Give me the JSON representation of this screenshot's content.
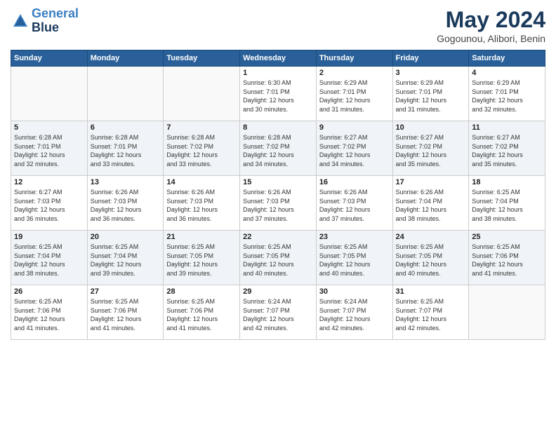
{
  "header": {
    "logo_line1": "General",
    "logo_line2": "Blue",
    "month": "May 2024",
    "location": "Gogounou, Alibori, Benin"
  },
  "weekdays": [
    "Sunday",
    "Monday",
    "Tuesday",
    "Wednesday",
    "Thursday",
    "Friday",
    "Saturday"
  ],
  "weeks": [
    [
      {
        "day": "",
        "info": ""
      },
      {
        "day": "",
        "info": ""
      },
      {
        "day": "",
        "info": ""
      },
      {
        "day": "1",
        "info": "Sunrise: 6:30 AM\nSunset: 7:01 PM\nDaylight: 12 hours\nand 30 minutes."
      },
      {
        "day": "2",
        "info": "Sunrise: 6:29 AM\nSunset: 7:01 PM\nDaylight: 12 hours\nand 31 minutes."
      },
      {
        "day": "3",
        "info": "Sunrise: 6:29 AM\nSunset: 7:01 PM\nDaylight: 12 hours\nand 31 minutes."
      },
      {
        "day": "4",
        "info": "Sunrise: 6:29 AM\nSunset: 7:01 PM\nDaylight: 12 hours\nand 32 minutes."
      }
    ],
    [
      {
        "day": "5",
        "info": "Sunrise: 6:28 AM\nSunset: 7:01 PM\nDaylight: 12 hours\nand 32 minutes."
      },
      {
        "day": "6",
        "info": "Sunrise: 6:28 AM\nSunset: 7:01 PM\nDaylight: 12 hours\nand 33 minutes."
      },
      {
        "day": "7",
        "info": "Sunrise: 6:28 AM\nSunset: 7:02 PM\nDaylight: 12 hours\nand 33 minutes."
      },
      {
        "day": "8",
        "info": "Sunrise: 6:28 AM\nSunset: 7:02 PM\nDaylight: 12 hours\nand 34 minutes."
      },
      {
        "day": "9",
        "info": "Sunrise: 6:27 AM\nSunset: 7:02 PM\nDaylight: 12 hours\nand 34 minutes."
      },
      {
        "day": "10",
        "info": "Sunrise: 6:27 AM\nSunset: 7:02 PM\nDaylight: 12 hours\nand 35 minutes."
      },
      {
        "day": "11",
        "info": "Sunrise: 6:27 AM\nSunset: 7:02 PM\nDaylight: 12 hours\nand 35 minutes."
      }
    ],
    [
      {
        "day": "12",
        "info": "Sunrise: 6:27 AM\nSunset: 7:03 PM\nDaylight: 12 hours\nand 36 minutes."
      },
      {
        "day": "13",
        "info": "Sunrise: 6:26 AM\nSunset: 7:03 PM\nDaylight: 12 hours\nand 36 minutes."
      },
      {
        "day": "14",
        "info": "Sunrise: 6:26 AM\nSunset: 7:03 PM\nDaylight: 12 hours\nand 36 minutes."
      },
      {
        "day": "15",
        "info": "Sunrise: 6:26 AM\nSunset: 7:03 PM\nDaylight: 12 hours\nand 37 minutes."
      },
      {
        "day": "16",
        "info": "Sunrise: 6:26 AM\nSunset: 7:03 PM\nDaylight: 12 hours\nand 37 minutes."
      },
      {
        "day": "17",
        "info": "Sunrise: 6:26 AM\nSunset: 7:04 PM\nDaylight: 12 hours\nand 38 minutes."
      },
      {
        "day": "18",
        "info": "Sunrise: 6:25 AM\nSunset: 7:04 PM\nDaylight: 12 hours\nand 38 minutes."
      }
    ],
    [
      {
        "day": "19",
        "info": "Sunrise: 6:25 AM\nSunset: 7:04 PM\nDaylight: 12 hours\nand 38 minutes."
      },
      {
        "day": "20",
        "info": "Sunrise: 6:25 AM\nSunset: 7:04 PM\nDaylight: 12 hours\nand 39 minutes."
      },
      {
        "day": "21",
        "info": "Sunrise: 6:25 AM\nSunset: 7:05 PM\nDaylight: 12 hours\nand 39 minutes."
      },
      {
        "day": "22",
        "info": "Sunrise: 6:25 AM\nSunset: 7:05 PM\nDaylight: 12 hours\nand 40 minutes."
      },
      {
        "day": "23",
        "info": "Sunrise: 6:25 AM\nSunset: 7:05 PM\nDaylight: 12 hours\nand 40 minutes."
      },
      {
        "day": "24",
        "info": "Sunrise: 6:25 AM\nSunset: 7:05 PM\nDaylight: 12 hours\nand 40 minutes."
      },
      {
        "day": "25",
        "info": "Sunrise: 6:25 AM\nSunset: 7:06 PM\nDaylight: 12 hours\nand 41 minutes."
      }
    ],
    [
      {
        "day": "26",
        "info": "Sunrise: 6:25 AM\nSunset: 7:06 PM\nDaylight: 12 hours\nand 41 minutes."
      },
      {
        "day": "27",
        "info": "Sunrise: 6:25 AM\nSunset: 7:06 PM\nDaylight: 12 hours\nand 41 minutes."
      },
      {
        "day": "28",
        "info": "Sunrise: 6:25 AM\nSunset: 7:06 PM\nDaylight: 12 hours\nand 41 minutes."
      },
      {
        "day": "29",
        "info": "Sunrise: 6:24 AM\nSunset: 7:07 PM\nDaylight: 12 hours\nand 42 minutes."
      },
      {
        "day": "30",
        "info": "Sunrise: 6:24 AM\nSunset: 7:07 PM\nDaylight: 12 hours\nand 42 minutes."
      },
      {
        "day": "31",
        "info": "Sunrise: 6:25 AM\nSunset: 7:07 PM\nDaylight: 12 hours\nand 42 minutes."
      },
      {
        "day": "",
        "info": ""
      }
    ]
  ]
}
